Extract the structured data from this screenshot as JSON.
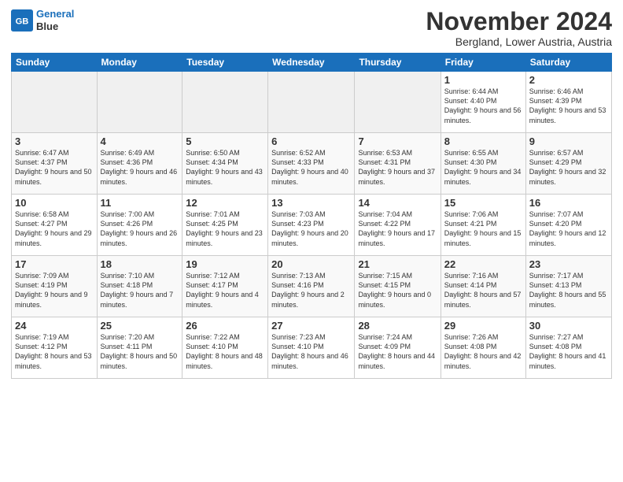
{
  "logo": {
    "line1": "General",
    "line2": "Blue"
  },
  "title": "November 2024",
  "location": "Bergland, Lower Austria, Austria",
  "weekdays": [
    "Sunday",
    "Monday",
    "Tuesday",
    "Wednesday",
    "Thursday",
    "Friday",
    "Saturday"
  ],
  "weeks": [
    [
      {
        "day": "",
        "info": ""
      },
      {
        "day": "",
        "info": ""
      },
      {
        "day": "",
        "info": ""
      },
      {
        "day": "",
        "info": ""
      },
      {
        "day": "",
        "info": ""
      },
      {
        "day": "1",
        "info": "Sunrise: 6:44 AM\nSunset: 4:40 PM\nDaylight: 9 hours and 56 minutes."
      },
      {
        "day": "2",
        "info": "Sunrise: 6:46 AM\nSunset: 4:39 PM\nDaylight: 9 hours and 53 minutes."
      }
    ],
    [
      {
        "day": "3",
        "info": "Sunrise: 6:47 AM\nSunset: 4:37 PM\nDaylight: 9 hours and 50 minutes."
      },
      {
        "day": "4",
        "info": "Sunrise: 6:49 AM\nSunset: 4:36 PM\nDaylight: 9 hours and 46 minutes."
      },
      {
        "day": "5",
        "info": "Sunrise: 6:50 AM\nSunset: 4:34 PM\nDaylight: 9 hours and 43 minutes."
      },
      {
        "day": "6",
        "info": "Sunrise: 6:52 AM\nSunset: 4:33 PM\nDaylight: 9 hours and 40 minutes."
      },
      {
        "day": "7",
        "info": "Sunrise: 6:53 AM\nSunset: 4:31 PM\nDaylight: 9 hours and 37 minutes."
      },
      {
        "day": "8",
        "info": "Sunrise: 6:55 AM\nSunset: 4:30 PM\nDaylight: 9 hours and 34 minutes."
      },
      {
        "day": "9",
        "info": "Sunrise: 6:57 AM\nSunset: 4:29 PM\nDaylight: 9 hours and 32 minutes."
      }
    ],
    [
      {
        "day": "10",
        "info": "Sunrise: 6:58 AM\nSunset: 4:27 PM\nDaylight: 9 hours and 29 minutes."
      },
      {
        "day": "11",
        "info": "Sunrise: 7:00 AM\nSunset: 4:26 PM\nDaylight: 9 hours and 26 minutes."
      },
      {
        "day": "12",
        "info": "Sunrise: 7:01 AM\nSunset: 4:25 PM\nDaylight: 9 hours and 23 minutes."
      },
      {
        "day": "13",
        "info": "Sunrise: 7:03 AM\nSunset: 4:23 PM\nDaylight: 9 hours and 20 minutes."
      },
      {
        "day": "14",
        "info": "Sunrise: 7:04 AM\nSunset: 4:22 PM\nDaylight: 9 hours and 17 minutes."
      },
      {
        "day": "15",
        "info": "Sunrise: 7:06 AM\nSunset: 4:21 PM\nDaylight: 9 hours and 15 minutes."
      },
      {
        "day": "16",
        "info": "Sunrise: 7:07 AM\nSunset: 4:20 PM\nDaylight: 9 hours and 12 minutes."
      }
    ],
    [
      {
        "day": "17",
        "info": "Sunrise: 7:09 AM\nSunset: 4:19 PM\nDaylight: 9 hours and 9 minutes."
      },
      {
        "day": "18",
        "info": "Sunrise: 7:10 AM\nSunset: 4:18 PM\nDaylight: 9 hours and 7 minutes."
      },
      {
        "day": "19",
        "info": "Sunrise: 7:12 AM\nSunset: 4:17 PM\nDaylight: 9 hours and 4 minutes."
      },
      {
        "day": "20",
        "info": "Sunrise: 7:13 AM\nSunset: 4:16 PM\nDaylight: 9 hours and 2 minutes."
      },
      {
        "day": "21",
        "info": "Sunrise: 7:15 AM\nSunset: 4:15 PM\nDaylight: 9 hours and 0 minutes."
      },
      {
        "day": "22",
        "info": "Sunrise: 7:16 AM\nSunset: 4:14 PM\nDaylight: 8 hours and 57 minutes."
      },
      {
        "day": "23",
        "info": "Sunrise: 7:17 AM\nSunset: 4:13 PM\nDaylight: 8 hours and 55 minutes."
      }
    ],
    [
      {
        "day": "24",
        "info": "Sunrise: 7:19 AM\nSunset: 4:12 PM\nDaylight: 8 hours and 53 minutes."
      },
      {
        "day": "25",
        "info": "Sunrise: 7:20 AM\nSunset: 4:11 PM\nDaylight: 8 hours and 50 minutes."
      },
      {
        "day": "26",
        "info": "Sunrise: 7:22 AM\nSunset: 4:10 PM\nDaylight: 8 hours and 48 minutes."
      },
      {
        "day": "27",
        "info": "Sunrise: 7:23 AM\nSunset: 4:10 PM\nDaylight: 8 hours and 46 minutes."
      },
      {
        "day": "28",
        "info": "Sunrise: 7:24 AM\nSunset: 4:09 PM\nDaylight: 8 hours and 44 minutes."
      },
      {
        "day": "29",
        "info": "Sunrise: 7:26 AM\nSunset: 4:08 PM\nDaylight: 8 hours and 42 minutes."
      },
      {
        "day": "30",
        "info": "Sunrise: 7:27 AM\nSunset: 4:08 PM\nDaylight: 8 hours and 41 minutes."
      }
    ]
  ]
}
